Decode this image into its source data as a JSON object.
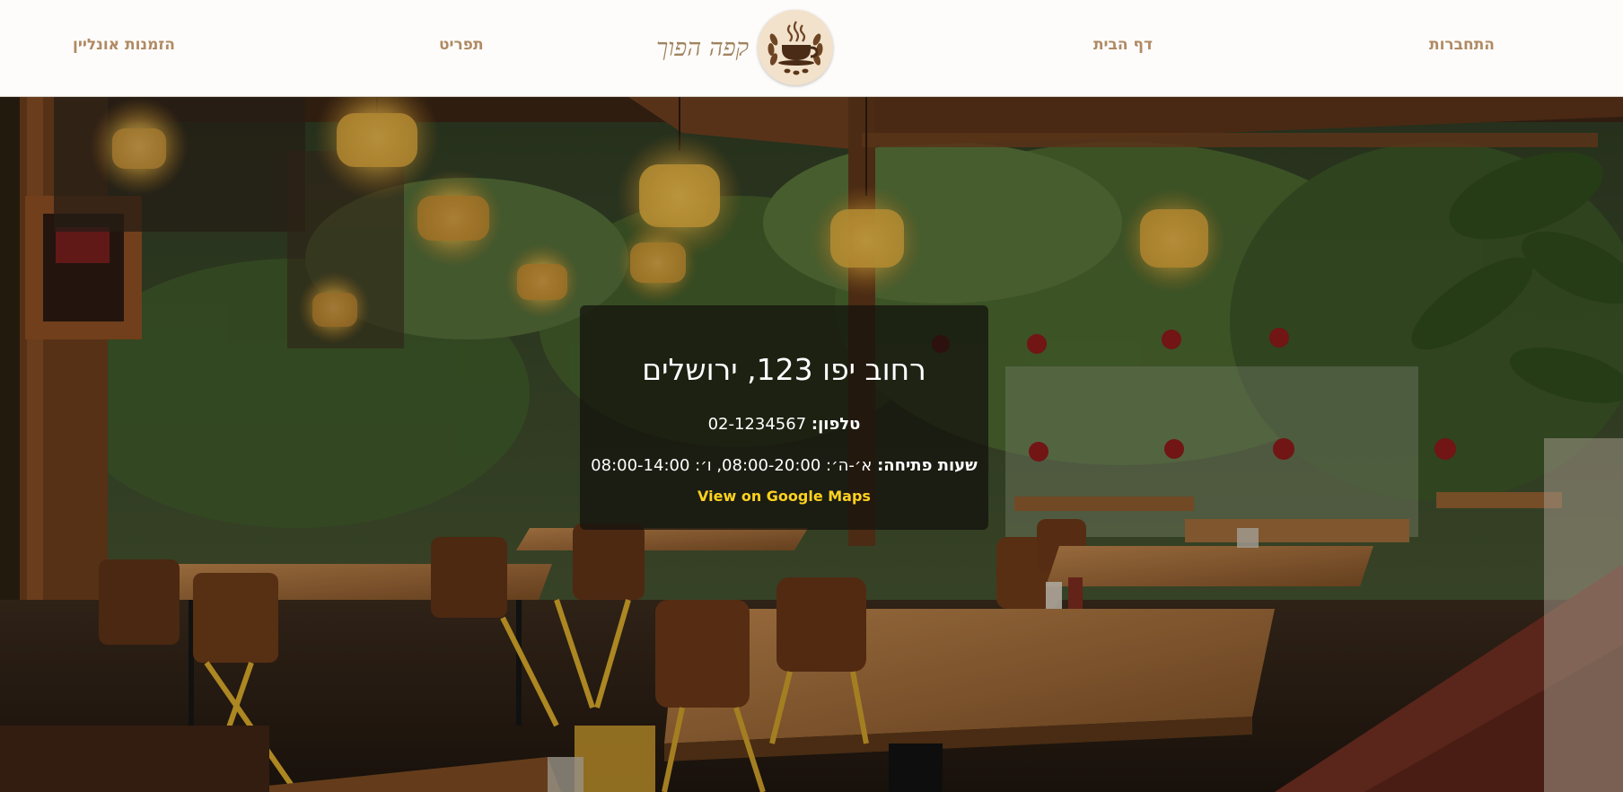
{
  "header": {
    "brand_name": "קפה הפוך",
    "nav": {
      "login": "התחברות",
      "home": "דף הבית",
      "menu": "תפריט",
      "order_online": "הזמנות אונליין"
    },
    "logo_icon": "coffee-cup-logo-icon"
  },
  "info": {
    "address": "רחוב יפו 123, ירושלים",
    "phone_label": "טלפון:",
    "phone_value": "02-1234567",
    "hours_label": "שעות פתיחה:",
    "hours_value": "א׳-ה׳: 08:00-20:00, ו׳: 08:00-14:00",
    "maps_link": "View on Google Maps"
  },
  "colors": {
    "nav_text": "#b08a63",
    "brand_text": "#a0845f",
    "link_yellow": "#ffd21f",
    "header_bg": "#fdfcfb"
  }
}
